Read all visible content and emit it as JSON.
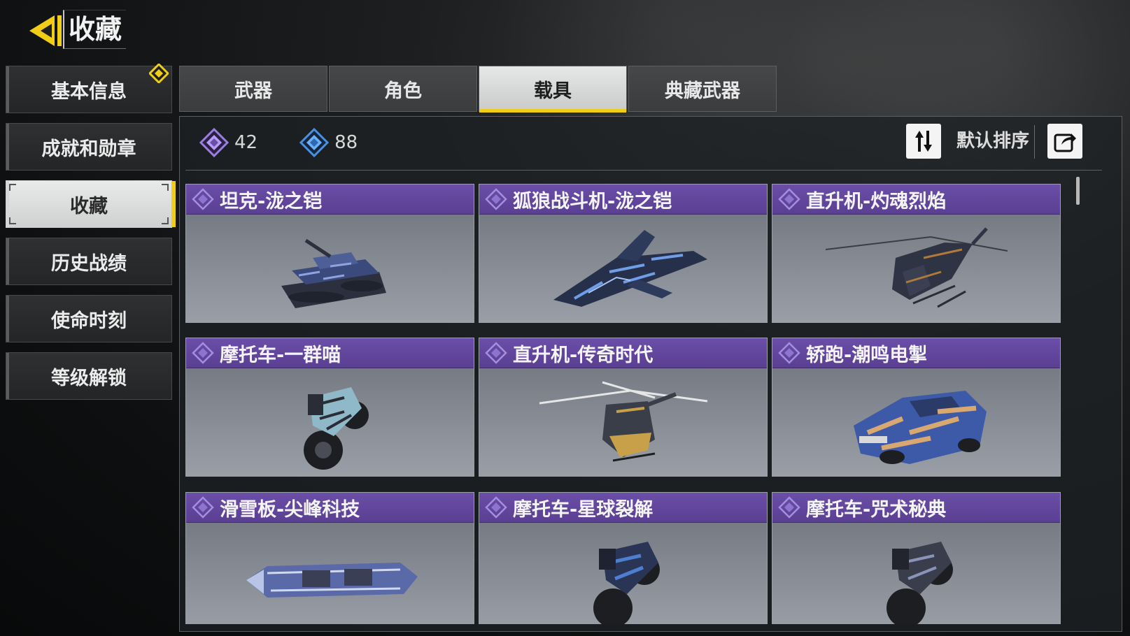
{
  "header": {
    "title": "收藏"
  },
  "menu": {
    "items": [
      {
        "label": "基本信息",
        "badge": true
      },
      {
        "label": "成就和勋章"
      },
      {
        "label": "收藏",
        "active": true
      },
      {
        "label": "历史战绩"
      },
      {
        "label": "使命时刻"
      },
      {
        "label": "等级解锁"
      }
    ]
  },
  "tabs": [
    {
      "label": "武器"
    },
    {
      "label": "角色"
    },
    {
      "label": "载具",
      "active": true
    },
    {
      "label": "典藏武器"
    }
  ],
  "stats": {
    "purple_count": "42",
    "blue_count": "88"
  },
  "sort": {
    "label": "默认排序"
  },
  "colors": {
    "accent": "#f0cd16",
    "rarity_purple": "#6b4ea8",
    "rarity_blue": "#3a7bd5"
  },
  "cards": [
    {
      "name": "坦克-泷之铠",
      "icon": "tank-icon"
    },
    {
      "name": "狐狼战斗机-泷之铠",
      "icon": "jet-icon"
    },
    {
      "name": "直升机-灼魂烈焰",
      "icon": "helicopter-icon"
    },
    {
      "name": "摩托车-一群喵",
      "icon": "motorcycle-icon"
    },
    {
      "name": "直升机-传奇时代",
      "icon": "helicopter-icon"
    },
    {
      "name": "轿跑-潮鸣电掣",
      "icon": "car-icon"
    },
    {
      "name": "滑雪板-尖峰科技",
      "icon": "snowboard-icon"
    },
    {
      "name": "摩托车-星球裂解",
      "icon": "motorcycle-icon"
    },
    {
      "name": "摩托车-咒术秘典",
      "icon": "motorcycle-icon"
    }
  ]
}
